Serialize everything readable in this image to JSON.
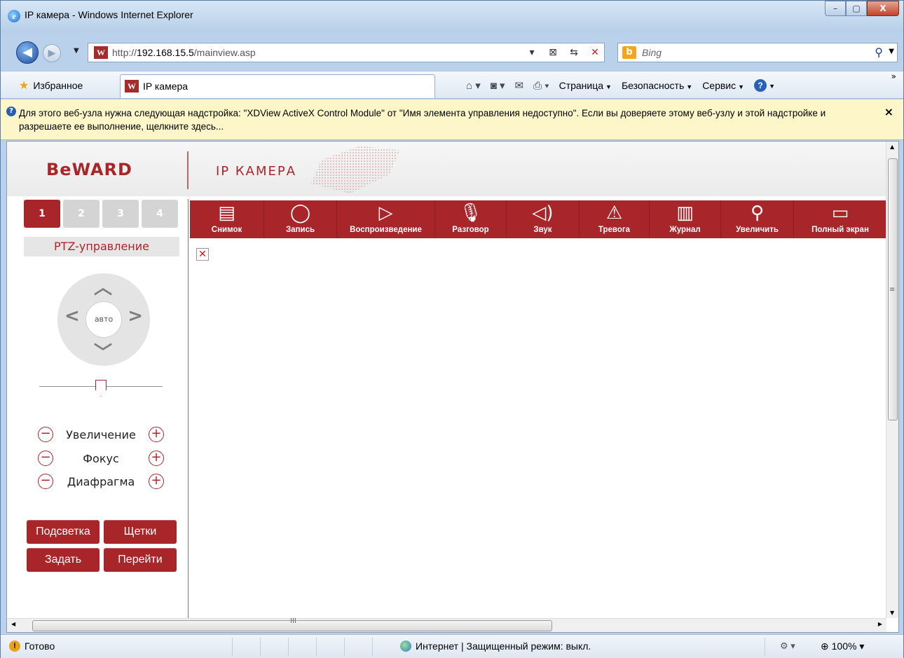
{
  "window": {
    "title": "IP камера - Windows Internet Explorer",
    "buttons": {
      "minimize": "–",
      "maximize": "▢",
      "close": "X"
    }
  },
  "address_bar": {
    "url_prefix": "http://",
    "url_host": "192.168.15.5",
    "url_path": "/mainview.asp",
    "search_placeholder": "Bing"
  },
  "command_bar": {
    "favorites_label": "Избранное",
    "tab_label": "IP камера",
    "menus": [
      "Страница",
      "Безопасность",
      "Сервис"
    ]
  },
  "info_bar": {
    "text": "Для этого веб-узла нужна следующая надстройка: \"XDView ActiveX Control Module\" от \"Имя элемента управления недоступно\". Если вы доверяете этому веб-узлу и этой надстройке и разрешаете ее выполнение, щелкните здесь...",
    "close": "×"
  },
  "page": {
    "logo": "BeWARD",
    "title": "IP КАМЕРА",
    "camera_tabs": [
      "1",
      "2",
      "3",
      "4"
    ],
    "active_camera": "1",
    "ptz_label": "PTZ-управление",
    "dpad_center": "авто",
    "controls": [
      {
        "label": "Увеличение"
      },
      {
        "label": "Фокус"
      },
      {
        "label": "Диафрагма"
      }
    ],
    "buttons": {
      "backlight": "Подсветка",
      "wipers": "Щетки",
      "set": "Задать",
      "goto": "Перейти"
    },
    "toolbar": [
      {
        "label": "Снимок",
        "icon": "film-icon"
      },
      {
        "label": "Запись",
        "icon": "record-icon"
      },
      {
        "label": "Воспроизведение",
        "icon": "play-icon"
      },
      {
        "label": "Разговор",
        "icon": "microphone-icon"
      },
      {
        "label": "Звук",
        "icon": "speaker-icon"
      },
      {
        "label": "Тревога",
        "icon": "alarm-icon"
      },
      {
        "label": "Журнал",
        "icon": "clipboard-icon"
      },
      {
        "label": "Увеличить",
        "icon": "magnifier-icon"
      },
      {
        "label": "Полный экран",
        "icon": "monitor-icon"
      }
    ]
  },
  "status_bar": {
    "status": "Готово",
    "zone": "Интернет | Защищенный режим: выкл.",
    "zoom": "100%"
  },
  "colors": {
    "brand_red": "#a8262a",
    "infobar_bg": "#fdf6c9"
  }
}
